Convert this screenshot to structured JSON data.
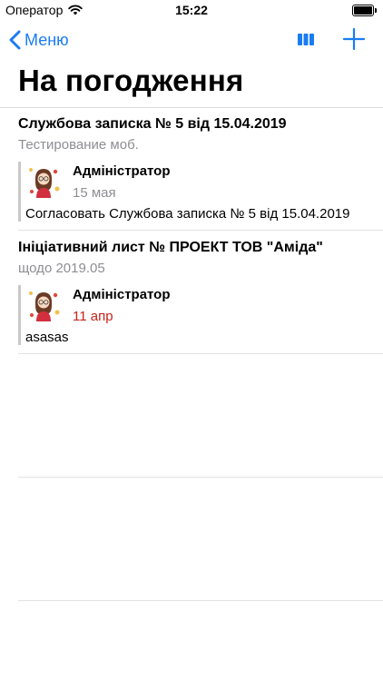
{
  "status_bar": {
    "carrier": "Оператор",
    "time": "15:22"
  },
  "nav": {
    "back_label": "Меню",
    "accent_color": "#1a7cf2"
  },
  "page": {
    "title": "На погодження"
  },
  "documents": [
    {
      "title": "Службова записка № 5 від 15.04.2019",
      "subtitle": "Тестирование моб.",
      "comment": {
        "author": "Адміністратор",
        "date": "15 мая",
        "date_color": "#8e8e93",
        "text": "Согласовать Службова записка № 5 від 15.04.2019"
      }
    },
    {
      "title": "Ініціативний лист № ПРОЕКТ ТОВ \"Аміда\"",
      "subtitle": "щодо 2019.05",
      "comment": {
        "author": "Адміністратор",
        "date": "11 апр",
        "date_color": "#c8211b",
        "text": "asasas"
      }
    }
  ],
  "icons": {
    "back": "chevron-left-icon",
    "columns": "columns-icon",
    "add": "plus-icon",
    "wifi": "wifi-icon",
    "battery": "battery-icon",
    "avatar": "avatar-illustration"
  }
}
